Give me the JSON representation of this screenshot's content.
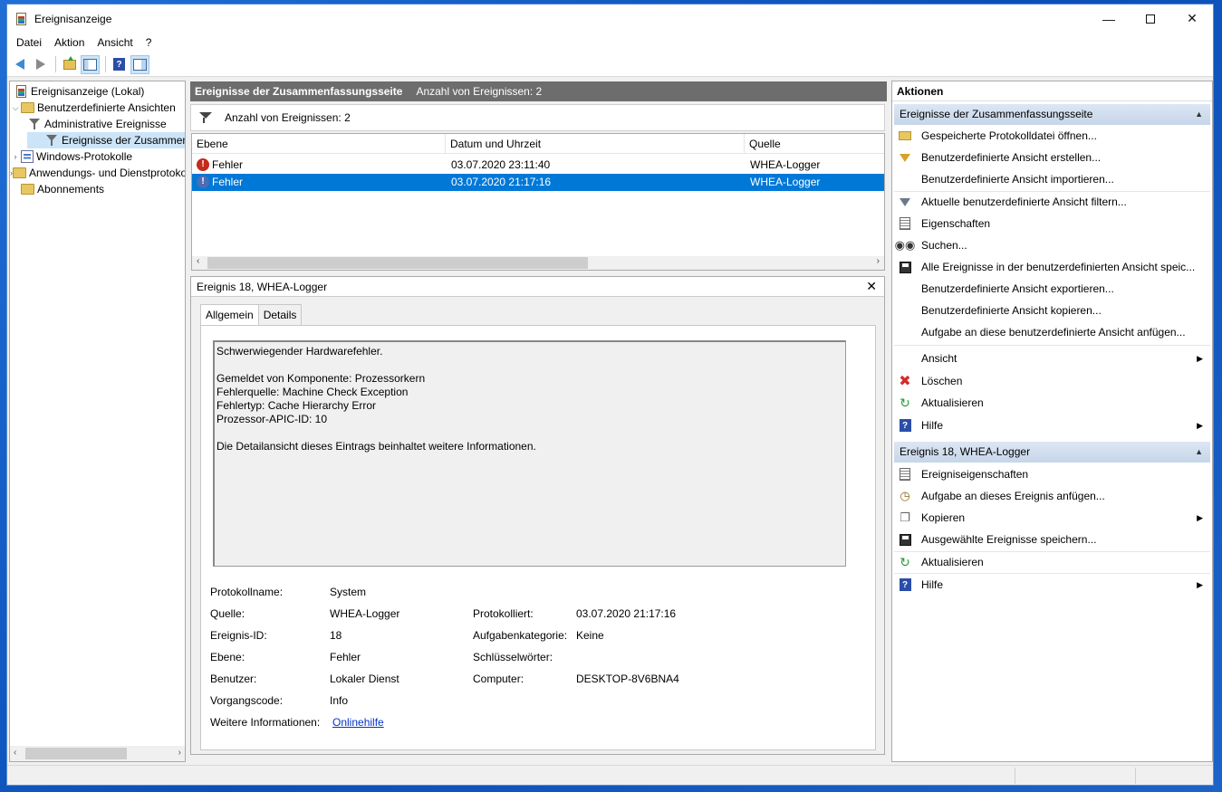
{
  "window": {
    "title": "Ereignisanzeige",
    "minimize_icon": "minimize-icon",
    "maximize_icon": "maximize-icon",
    "close_icon": "close-icon"
  },
  "menu": [
    "Datei",
    "Aktion",
    "Ansicht",
    "?"
  ],
  "toolbar": [
    "back-arrow-icon",
    "forward-arrow-icon",
    "folder-up-icon",
    "show-pane-icon",
    "help-icon",
    "show-action-pane-icon"
  ],
  "tree": {
    "root": "Ereignisanzeige (Lokal)",
    "custom_views": "Benutzerdefinierte Ansichten",
    "admin_events": "Administrative Ereignisse",
    "summary_events": "Ereignisse der Zusammenfassungsseite",
    "windows_logs": "Windows-Protokolle",
    "app_service_logs": "Anwendungs- und Dienstprotokolle",
    "subscriptions": "Abonnements"
  },
  "middle": {
    "header_title": "Ereignisse der Zusammenfassungsseite",
    "header_count": "Anzahl von Ereignissen: 2",
    "filter_text": "Anzahl von Ereignissen: 2",
    "columns": [
      "Ebene",
      "Datum und Uhrzeit",
      "Quelle"
    ],
    "rows": [
      {
        "level": "Fehler",
        "datetime": "03.07.2020 23:11:40",
        "source": "WHEA-Logger"
      },
      {
        "level": "Fehler",
        "datetime": "03.07.2020 21:17:16",
        "source": "WHEA-Logger"
      }
    ]
  },
  "detail": {
    "title": "Ereignis 18, WHEA-Logger",
    "tabs": [
      "Allgemein",
      "Details"
    ],
    "message": "Schwerwiegender Hardwarefehler.\n\nGemeldet von Komponente: Prozessorkern\nFehlerquelle: Machine Check Exception\nFehlertyp: Cache Hierarchy Error\nProzessor-APIC-ID: 10\n\nDie Detailansicht dieses Eintrags beinhaltet weitere Informationen.",
    "labels": {
      "log_name": "Protokollname:",
      "source": "Quelle:",
      "event_id": "Ereignis-ID:",
      "level": "Ebene:",
      "user": "Benutzer:",
      "opcode": "Vorgangscode:",
      "more_info": "Weitere Informationen:",
      "logged": "Protokolliert:",
      "task_category": "Aufgabenkategorie:",
      "keywords": "Schlüsselwörter:",
      "computer": "Computer:"
    },
    "values": {
      "log_name": "System",
      "source": "WHEA-Logger",
      "event_id": "18",
      "level": "Fehler",
      "user": "Lokaler Dienst",
      "opcode": "Info",
      "more_info": "Onlinehilfe",
      "logged": "03.07.2020 21:17:16",
      "task_category": "Keine",
      "keywords": "",
      "computer": "DESKTOP-8V6BNA4"
    }
  },
  "actions": {
    "title": "Aktionen",
    "section1": "Ereignisse der Zusammenfassungsseite",
    "items1": [
      {
        "label": "Gespeicherte Protokolldatei öffnen...",
        "icon": "open-folder-icon"
      },
      {
        "label": "Benutzerdefinierte Ansicht erstellen...",
        "icon": "create-filter-icon"
      },
      {
        "label": "Benutzerdefinierte Ansicht importieren...",
        "icon": ""
      },
      {
        "label": "Aktuelle benutzerdefinierte Ansicht filtern...",
        "icon": "filter-icon"
      },
      {
        "label": "Eigenschaften",
        "icon": "properties-icon"
      },
      {
        "label": "Suchen...",
        "icon": "binoculars-icon"
      },
      {
        "label": "Alle Ereignisse in der benutzerdefinierten Ansicht speic...",
        "icon": "save-icon"
      },
      {
        "label": "Benutzerdefinierte Ansicht exportieren...",
        "icon": ""
      },
      {
        "label": "Benutzerdefinierte Ansicht kopieren...",
        "icon": ""
      },
      {
        "label": "Aufgabe an diese benutzerdefinierte Ansicht anfügen...",
        "icon": ""
      },
      {
        "label": "Ansicht",
        "icon": ""
      },
      {
        "label": "Löschen",
        "icon": "delete-icon"
      },
      {
        "label": "Aktualisieren",
        "icon": "refresh-icon"
      },
      {
        "label": "Hilfe",
        "icon": "help-icon"
      }
    ],
    "section2": "Ereignis 18, WHEA-Logger",
    "items2": [
      {
        "label": "Ereigniseigenschaften",
        "icon": "event-properties-icon"
      },
      {
        "label": "Aufgabe an dieses Ereignis anfügen...",
        "icon": "attach-task-icon"
      },
      {
        "label": "Kopieren",
        "icon": "copy-icon"
      },
      {
        "label": "Ausgewählte Ereignisse speichern...",
        "icon": "save-icon"
      },
      {
        "label": "Aktualisieren",
        "icon": "refresh-icon"
      },
      {
        "label": "Hilfe",
        "icon": "help-icon"
      }
    ]
  },
  "colors": {
    "selection": "#0078d7",
    "error": "#c42b1c",
    "section_header": "#c6d5e9",
    "pane_header": "#6d6d6d"
  }
}
